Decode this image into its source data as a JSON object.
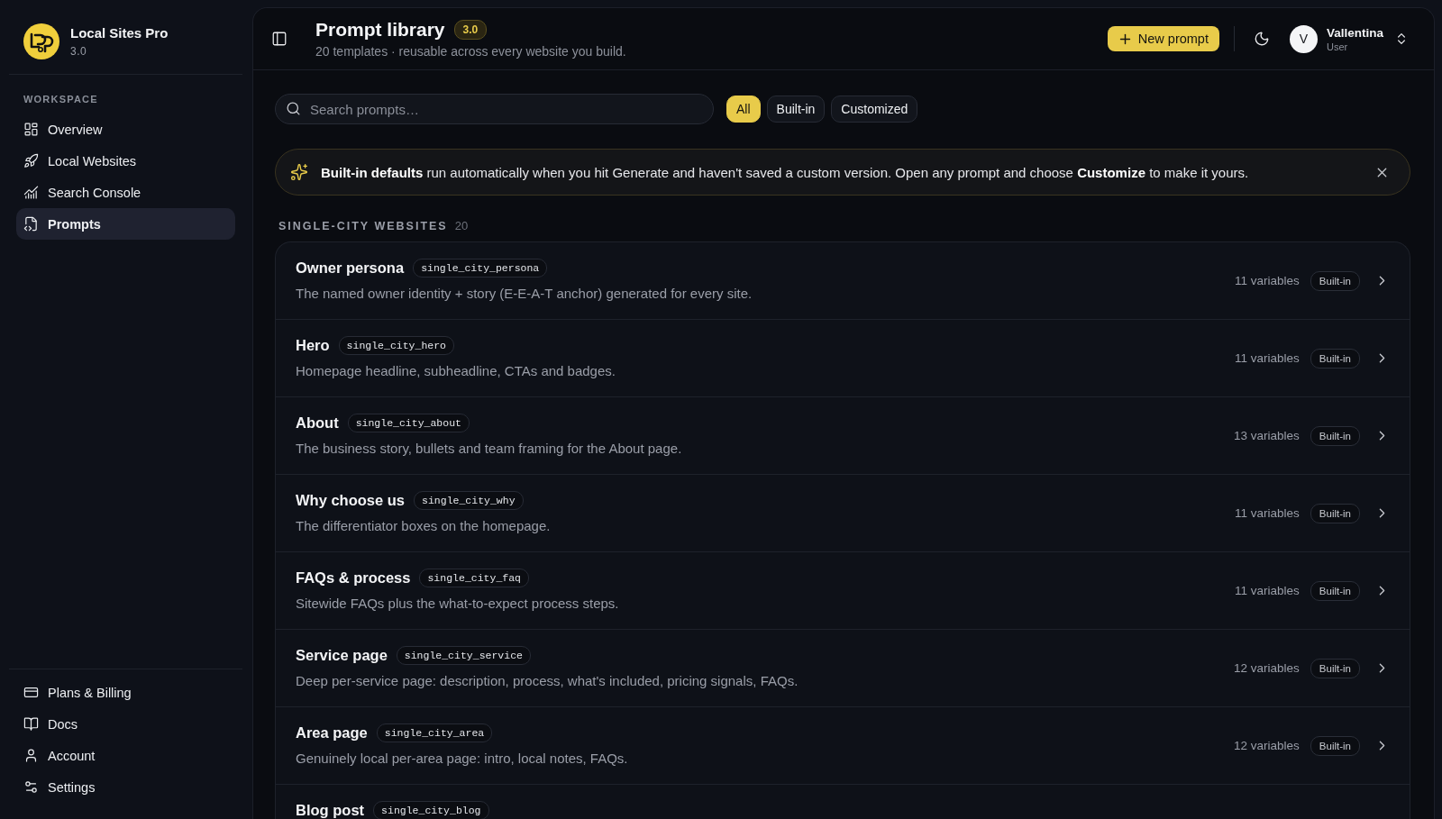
{
  "sidebar": {
    "brand": {
      "name": "Local Sites Pro",
      "version": "3.0"
    },
    "section_label": "WORKSPACE",
    "items": [
      {
        "label": "Overview",
        "selected": false
      },
      {
        "label": "Local Websites",
        "selected": false
      },
      {
        "label": "Search Console",
        "selected": false
      },
      {
        "label": "Prompts",
        "selected": true
      }
    ],
    "footer_items": [
      {
        "label": "Plans & Billing"
      },
      {
        "label": "Docs"
      },
      {
        "label": "Account"
      },
      {
        "label": "Settings"
      }
    ]
  },
  "header": {
    "title": "Prompt library",
    "version_badge": "3.0",
    "subtitle": "20 templates · reusable across every website you build.",
    "new_button": "New prompt",
    "user": {
      "initial": "V",
      "name": "Vallentina",
      "role": "User"
    }
  },
  "filters": {
    "search": {
      "placeholder": "Search prompts…"
    },
    "chips": [
      {
        "label": "All",
        "selected": true
      },
      {
        "label": "Built-in",
        "selected": false
      },
      {
        "label": "Customized",
        "selected": false
      }
    ]
  },
  "banner": {
    "text": "**Built-in defaults** run automatically when you hit Generate and haven't saved a custom version. Open any prompt and choose **Customize** to make it yours."
  },
  "section": {
    "title": "SINGLE-CITY WEBSITES",
    "count": "20",
    "rows": [
      {
        "title": "Owner persona",
        "key": "single_city_persona",
        "description": "The named owner identity + story (E-E-A-T anchor) generated for every site.",
        "variables": "11 variables",
        "badge": "Built-in"
      },
      {
        "title": "Hero",
        "key": "single_city_hero",
        "description": "Homepage headline, subheadline, CTAs and badges.",
        "variables": "11 variables",
        "badge": "Built-in"
      },
      {
        "title": "About",
        "key": "single_city_about",
        "description": "The business story, bullets and team framing for the About page.",
        "variables": "13 variables",
        "badge": "Built-in"
      },
      {
        "title": "Why choose us",
        "key": "single_city_why",
        "description": "The differentiator boxes on the homepage.",
        "variables": "11 variables",
        "badge": "Built-in"
      },
      {
        "title": "FAQs & process",
        "key": "single_city_faq",
        "description": "Sitewide FAQs plus the what-to-expect process steps.",
        "variables": "11 variables",
        "badge": "Built-in"
      },
      {
        "title": "Service page",
        "key": "single_city_service",
        "description": "Deep per-service page: description, process, what's included, pricing signals, FAQs.",
        "variables": "12 variables",
        "badge": "Built-in"
      },
      {
        "title": "Area page",
        "key": "single_city_area",
        "description": "Genuinely local per-area page: intro, local notes, FAQs.",
        "variables": "12 variables",
        "badge": "Built-in"
      },
      {
        "title": "Blog post",
        "key": "single_city_blog"
      }
    ]
  }
}
